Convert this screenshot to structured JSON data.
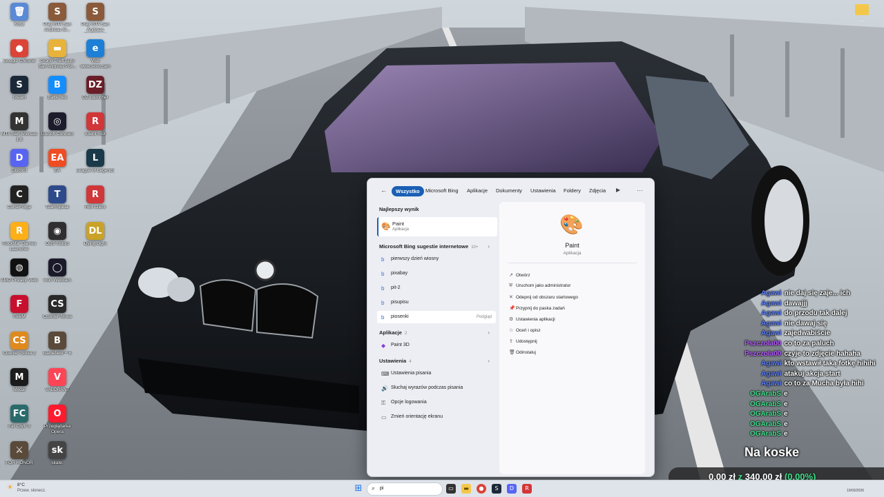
{
  "desktop": {
    "icons": [
      {
        "label": "Kosz",
        "glyph": "🗑",
        "color": "#5a8ad6"
      },
      {
        "label": "Play GTA San Andreas Si...",
        "glyph": "S",
        "color": "#8a5a3a"
      },
      {
        "label": "Play GTA San Andreas Multiplayer",
        "glyph": "S",
        "color": "#8a5a3a"
      },
      {
        "label": "Google Chrome",
        "glyph": "●",
        "color": "#db4437"
      },
      {
        "label": "Grand Theft Auto San Andreas Poli...",
        "glyph": "▬",
        "color": "#e8b33a"
      },
      {
        "label": "Visit www.sevo.cam",
        "glyph": "e",
        "color": "#1d7fd6"
      },
      {
        "label": "Steam",
        "glyph": "S",
        "color": "#1b2838"
      },
      {
        "label": "Battle.net",
        "glyph": "B",
        "color": "#148eff"
      },
      {
        "label": "DZ Launcher",
        "glyph": "DZ",
        "color": "#6a1e28"
      },
      {
        "label": "MTA San Andreas 1.6",
        "glyph": "M",
        "color": "#333333"
      },
      {
        "label": "Ubisoft Connect",
        "glyph": "◎",
        "color": "#1c1c2c"
      },
      {
        "label": "Klient Riot",
        "glyph": "R",
        "color": "#d13639"
      },
      {
        "label": "Discord",
        "glyph": "D",
        "color": "#5865f2"
      },
      {
        "label": "EA",
        "glyph": "EA",
        "color": "#f04c23"
      },
      {
        "label": "League of Legends",
        "glyph": "L",
        "color": "#1a3a4a"
      },
      {
        "label": "CurseForge",
        "glyph": "C",
        "color": "#222222"
      },
      {
        "label": "TeamSpeak",
        "glyph": "T",
        "color": "#2d4a8a"
      },
      {
        "label": "Riot Client",
        "glyph": "R",
        "color": "#d13639"
      },
      {
        "label": "Rockstar Games Launcher",
        "glyph": "R",
        "color": "#fcaf17"
      },
      {
        "label": "OBS Studio",
        "glyph": "◉",
        "color": "#302e31"
      },
      {
        "label": "Dying Light",
        "glyph": "DL",
        "color": "#c9a227"
      },
      {
        "label": "AMD Privacy View",
        "glyph": "◍",
        "color": "#111111"
      },
      {
        "label": "Iriun Webcam",
        "glyph": "◯",
        "color": "#1a1a2a"
      },
      {
        "label": "FiveM",
        "glyph": "F",
        "color": "#c8102e"
      },
      {
        "label": "Counter-Strike",
        "glyph": "CS",
        "color": "#2a2a2a"
      },
      {
        "label": "Counter-Strike 2",
        "glyph": "CS",
        "color": "#e08a1e"
      },
      {
        "label": "Battlefield™ 6",
        "glyph": "B",
        "color": "#5b4a3a"
      },
      {
        "label": "Medal",
        "glyph": "M",
        "color": "#1c1c1c"
      },
      {
        "label": "VALORANT",
        "glyph": "V",
        "color": "#fd4556"
      },
      {
        "label": "Far Cry® 3",
        "glyph": "FC",
        "color": "#2a6a6a"
      },
      {
        "label": "Przeglądarka Opera",
        "glyph": "O",
        "color": "#ff1b2d"
      },
      {
        "label": "FOR HONOR",
        "glyph": "⚔",
        "color": "#5a4a3a"
      },
      {
        "label": "skate.",
        "glyph": "sk",
        "color": "#444444"
      }
    ],
    "folder_icon_label": "",
    "corner_dots": "···"
  },
  "search_panel": {
    "back_icon": "←",
    "tabs": [
      "Wszystko",
      "Microsoft Bing",
      "Aplikacje",
      "Dokumenty",
      "Ustawienia",
      "Foldery",
      "Zdjęcia"
    ],
    "more_tabs_icon": "▶",
    "menu_icon": "···",
    "best_match_header": "Najlepszy wynik",
    "best_match": {
      "name": "Paint",
      "type": "Aplikacja"
    },
    "bing_header": "Microsoft Bing sugestie internetowe",
    "bing_count": "10+",
    "bing_suggestions": [
      "pierwszy dzień wiosny",
      "pixabay",
      "pit-2",
      "pisupisu",
      "piosenki"
    ],
    "preview_label": "Podgląd",
    "apps_header": "Aplikacje",
    "apps_count": "2",
    "apps": [
      "Paint 3D"
    ],
    "settings_header": "Ustawienia",
    "settings_count": "4",
    "settings": [
      "Ustawienia pisania",
      "Słuchaj wyrazów podczas pisania",
      "Opcje logowania",
      "Zmień orientację ekranu"
    ],
    "detail": {
      "name": "Paint",
      "type": "Aplikacja",
      "actions": [
        "Otwórz",
        "Uruchom jako administrator",
        "Odepnij od obszaru startowego",
        "Przypnij do paska zadań",
        "Ustawienia aplikacji",
        "Oceń i opisz",
        "Udostępnij",
        "Odinstaluj"
      ]
    }
  },
  "chat": [
    {
      "user": "Agawi",
      "color": "#5b7fff",
      "msg": "nie daj się zaje... ich"
    },
    {
      "user": "Agawi",
      "color": "#5b7fff",
      "msg": "dawajjj"
    },
    {
      "user": "Agawi",
      "color": "#5b7fff",
      "msg": "do przodu tak dalej"
    },
    {
      "user": "Agawi",
      "color": "#5b7fff",
      "msg": "nie dawaj się"
    },
    {
      "user": "Agawi",
      "color": "#5b7fff",
      "msg": "zajedwabiście"
    },
    {
      "user": "Pszczola00",
      "color": "#b65cff",
      "msg": "co to za paluch"
    },
    {
      "user": "Pszczola00",
      "color": "#b65cff",
      "msg": "czyje to zdjęcie hahaha"
    },
    {
      "user": "Agawi",
      "color": "#5b7fff",
      "msg": "kto wstawił taką fotkę hihihi"
    },
    {
      "user": "Agawi",
      "color": "#5b7fff",
      "msg": "atakuj akcja start"
    },
    {
      "user": "Agawi",
      "color": "#5b7fff",
      "msg": "co to za Mucha była hihi"
    },
    {
      "user": "OGArabS",
      "color": "#3fe08a",
      "msg": "e"
    },
    {
      "user": "OGArabS",
      "color": "#3fe08a",
      "msg": "e"
    },
    {
      "user": "OGArabS",
      "color": "#3fe08a",
      "msg": "e"
    },
    {
      "user": "OGArabS",
      "color": "#3fe08a",
      "msg": "e"
    },
    {
      "user": "OGArabS",
      "color": "#3fe08a",
      "msg": "e"
    }
  ],
  "overlay": {
    "title": "Na koske",
    "goal_current": "0,00 zł",
    "goal_sep": "z",
    "goal_target": "340,00 zł",
    "goal_percent": "(0.00%)",
    "goal_fraction": 0.0
  },
  "taskbar": {
    "weather_temp": "8°C",
    "weather_desc": "Przew. słonecz.",
    "search_text": "pi",
    "search_icon": "⌕",
    "time": "",
    "date": "10/03/2026"
  }
}
